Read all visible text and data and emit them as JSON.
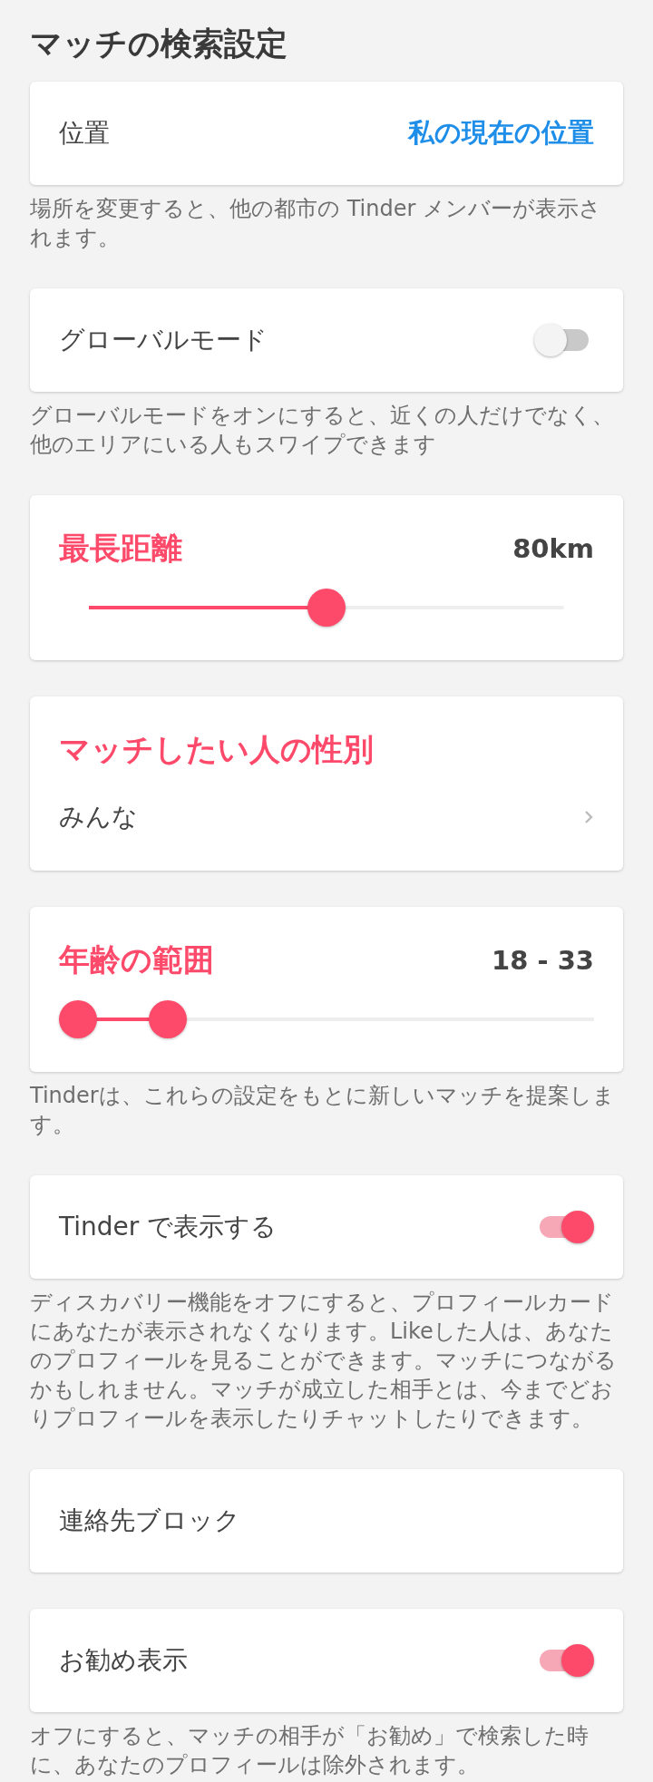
{
  "title": "マッチの検索設定",
  "sections": [
    {
      "kind": "link",
      "label": "位置",
      "value": "私の現在の位置",
      "note": "場所を変更すると、他の都市の Tinder メンバーが表示されます。"
    },
    {
      "kind": "toggle",
      "label": "グローバルモード",
      "on": false,
      "note": "グローバルモードをオンにすると、近くの人だけでなく、他のエリアにいる人もスワイプできます"
    },
    {
      "kind": "slider",
      "label": "最長距離",
      "value": "80km",
      "level": 0.5
    },
    {
      "kind": "choice",
      "label": "マッチしたい人の性別",
      "value": "みんな"
    },
    {
      "kind": "range",
      "label": "年齢の範囲",
      "value": "18 - 33",
      "thumbs": [
        {
          "level": 0
        },
        {
          "level": 0.18
        }
      ],
      "note": "Tinderは、これらの設定をもとに新しいマッチを提案します。"
    },
    {
      "kind": "toggle",
      "label": "Tinder で表示する",
      "on": true,
      "note": "ディスカバリー機能をオフにすると、プロフィールカードにあなたが表示されなくなります。Likeした人は、あなたのプロフィールを見ることができます。マッチにつながるかもしれません。マッチが成立した相手とは、今までどおりプロフィールを表示したりチャットしたりできます。"
    },
    {
      "kind": "plain",
      "label": "連絡先ブロック"
    },
    {
      "kind": "toggle",
      "label": "お勧め表示",
      "on": true,
      "note": "オフにすると、マッチの相手が「お勧め」で検索した時に、あなたのプロフィールは除外されます。"
    }
  ]
}
